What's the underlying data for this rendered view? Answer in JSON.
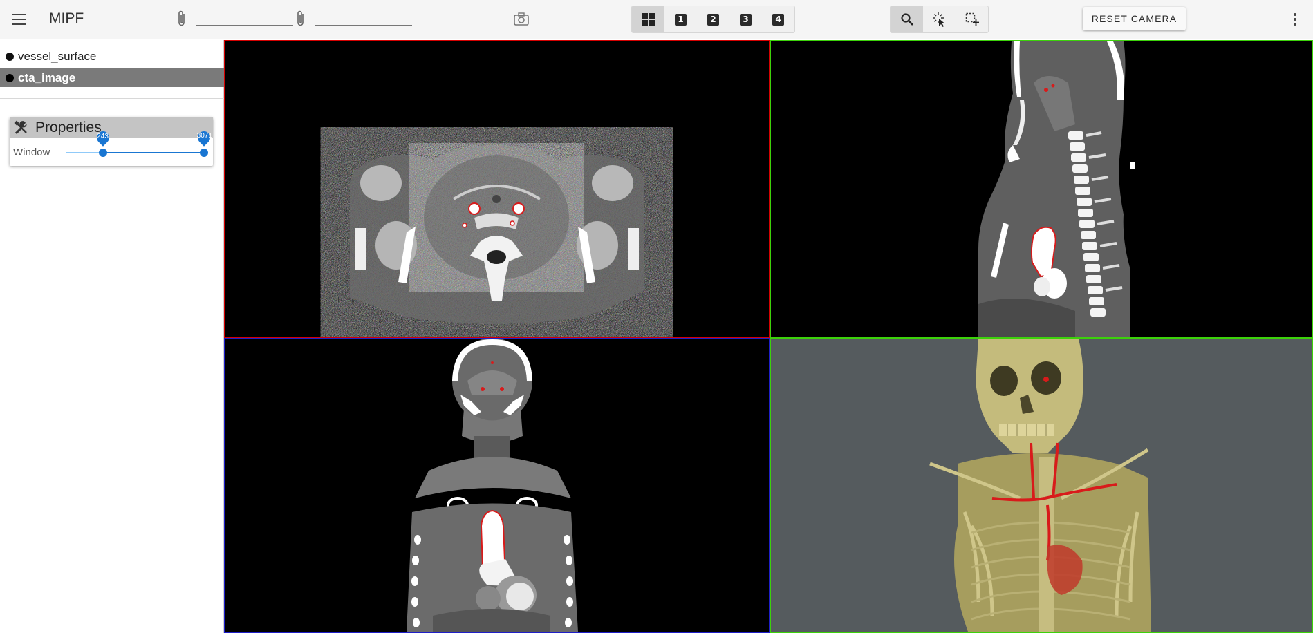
{
  "header": {
    "app_title": "MIPF",
    "reset_camera_label": "RESET CAMERA",
    "menu_icon": "hamburger-menu-icon",
    "layout_buttons": [
      "grid-layout-icon",
      "1",
      "2",
      "3",
      "4"
    ],
    "active_layout": "grid",
    "tool_buttons": [
      "zoom-icon",
      "select-pointer-icon",
      "box-select-icon"
    ],
    "active_tool": "zoom"
  },
  "layers": [
    {
      "label": "vessel_surface",
      "selected": false
    },
    {
      "label": "cta_image",
      "selected": true
    }
  ],
  "properties": {
    "title": "Properties",
    "window_label": "Window",
    "window_min": 243,
    "window_max": 3071,
    "low_label": "243",
    "high_label": "3071",
    "low_fraction": 0.27,
    "high_fraction": 1.0
  },
  "viewports": [
    {
      "name": "axial",
      "border_color": "#d50000"
    },
    {
      "name": "sagittal",
      "border_color": "#3cd10a"
    },
    {
      "name": "coronal",
      "border_color": "#1e1ec8"
    },
    {
      "name": "3d",
      "border_color": "#3cd10a"
    }
  ],
  "colors": {
    "accent": "#1976d2",
    "vessel": "#d81b1b",
    "bone_3d": "#c4bb7c",
    "background_3d": "#555b5e"
  }
}
